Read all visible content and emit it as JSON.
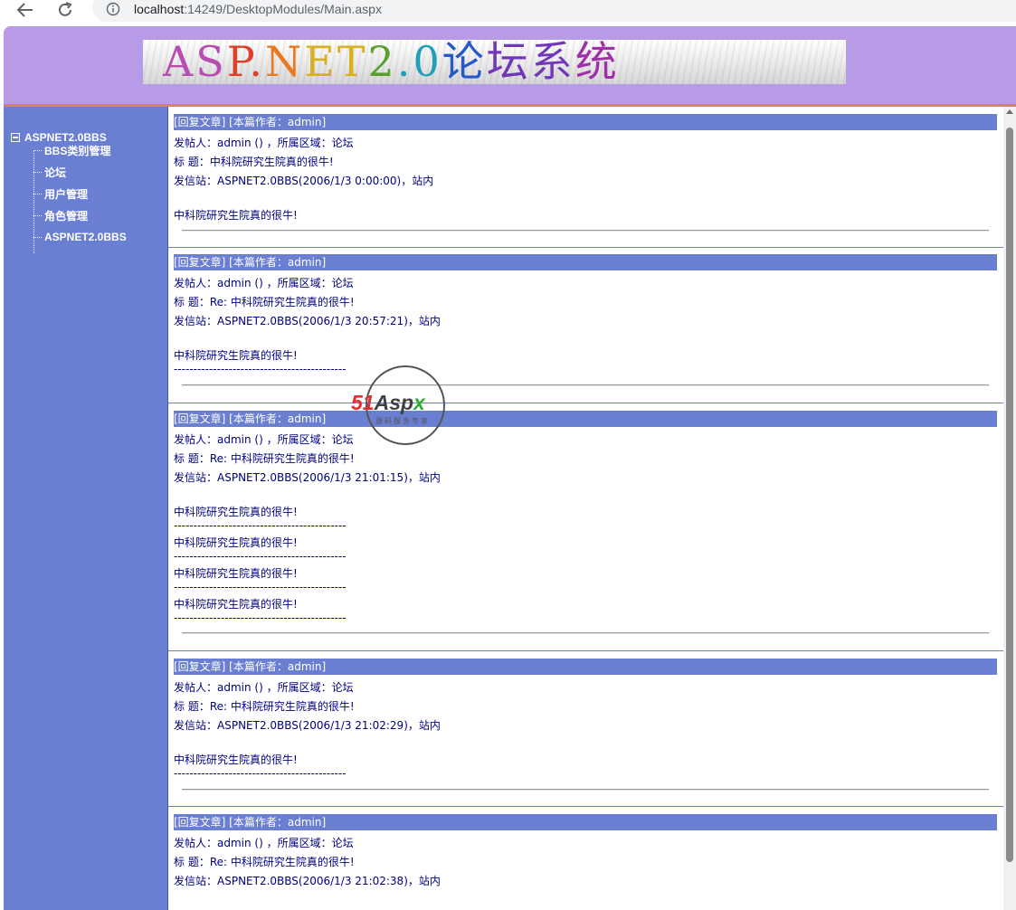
{
  "browser": {
    "url_host": "localhost",
    "url_rest": ":14249/DesktopModules/Main.aspx"
  },
  "header": {
    "banner_text": "ASP.NET2.0论坛系统"
  },
  "sidebar": {
    "root_label": "ASPNET2.0BBS",
    "items": [
      {
        "label": "BBS类别管理"
      },
      {
        "label": "论坛"
      },
      {
        "label": "用户管理"
      },
      {
        "label": "角色管理"
      },
      {
        "label": "ASPNET2.0BBS"
      }
    ]
  },
  "posts": [
    {
      "head": "[回复文章] [本篇作者：admin]",
      "poster": "发帖人：admin () ，所属区域：论坛",
      "title": "标    题：中科院研究生院真的很牛!",
      "station": "发信站：ASPNET2.0BBS(2006/1/3 0:00:00)，站内",
      "body": [
        "中科院研究生院真的很牛!"
      ],
      "dashes": ""
    },
    {
      "head": "[回复文章] [本篇作者：admin]",
      "poster": "发帖人：admin () ，所属区域：论坛",
      "title": "标    题：Re: 中科院研究生院真的很牛!",
      "station": "发信站：ASPNET2.0BBS(2006/1/3 20:57:21)，站内",
      "body": [
        "中科院研究生院真的很牛!"
      ],
      "dashes": "--------------------------------------------"
    },
    {
      "head": "[回复文章] [本篇作者：admin]",
      "poster": "发帖人：admin () ，所属区域：论坛",
      "title": "标    题：Re: 中科院研究生院真的很牛!",
      "station": "发信站：ASPNET2.0BBS(2006/1/3 21:01:15)，站内",
      "body": [
        "中科院研究生院真的很牛!",
        "中科院研究生院真的很牛!",
        "中科院研究生院真的很牛!",
        "中科院研究生院真的很牛!"
      ],
      "dashes": "--------------------------------------------"
    },
    {
      "head": "[回复文章] [本篇作者：admin]",
      "poster": "发帖人：admin () ，所属区域：论坛",
      "title": "标    题：Re: 中科院研究生院真的很牛!",
      "station": "发信站：ASPNET2.0BBS(2006/1/3 21:02:29)，站内",
      "body": [
        "中科院研究生院真的很牛!"
      ],
      "dashes": "--------------------------------------------"
    },
    {
      "head": "[回复文章] [本篇作者：admin]",
      "poster": "发帖人：admin () ，所属区域：论坛",
      "title": "标    题：Re: 中科院研究生院真的很牛!",
      "station": "发信站：ASPNET2.0BBS(2006/1/3 21:02:38)，站内",
      "body": [],
      "dashes": ""
    }
  ],
  "watermark": {
    "logo_num": "51",
    "logo_word": "Asp",
    "logo_x": "x",
    "subtitle": "源码服务专家"
  },
  "colors": {
    "header_bg": "#b89be6",
    "nav_bg": "#6a7fd2",
    "post_head_bg": "#6a7fd2",
    "text": "#000080",
    "banner_colors": [
      "#b84db0",
      "#e0402a",
      "#e87a24",
      "#d8b020",
      "#58a030",
      "#20a0b8",
      "#2858c8",
      "#7038b8",
      "#a030a8"
    ]
  }
}
